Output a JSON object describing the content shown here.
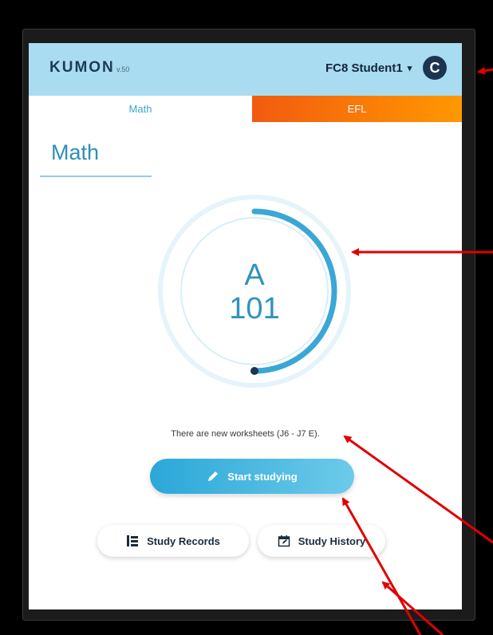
{
  "header": {
    "logo": "KUMON",
    "version": "v.50",
    "user_name": "FC8 Student1",
    "caret": "▾",
    "refresh_glyph": "C"
  },
  "tabs": [
    {
      "label": "Math",
      "active": true
    },
    {
      "label": "EFL",
      "active": false
    }
  ],
  "main": {
    "subject_title": "Math",
    "progress": 0.5,
    "level": "A",
    "worksheet_number": "101",
    "notice": "There are new worksheets (J6 - J7 E).",
    "start_label": "Start studying"
  },
  "footer": {
    "records_label": "Study Records",
    "history_label": "Study History"
  },
  "colors": {
    "header_bg": "#a9dcf0",
    "accent": "#2aa7d8",
    "efl_tab": "#f25a10",
    "annotation_arrow": "#e00000"
  }
}
